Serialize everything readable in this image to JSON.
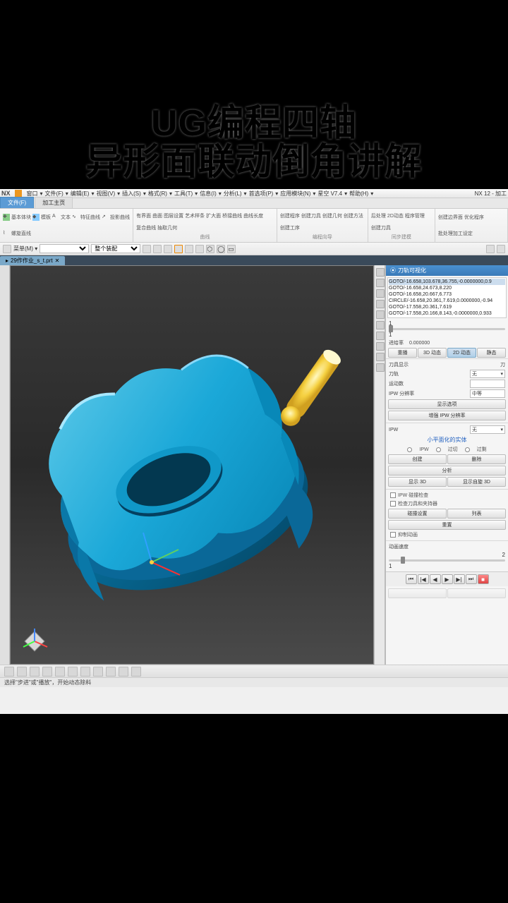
{
  "overlay": {
    "line1": "UG编程四轴",
    "line2": "异形面联动倒角讲解"
  },
  "menubar": {
    "logo": "NX",
    "items": [
      "窗口",
      "文件(F)",
      "编辑(E)",
      "视图(V)",
      "插入(S)",
      "格式(R)",
      "工具(T)",
      "信息(I)",
      "分析(L)",
      "首选项(P)",
      "应用模块(N)",
      "星空 V7.4",
      "帮助(H)"
    ],
    "right": "NX 12 - 加工"
  },
  "tabs": {
    "file": "文件(F)",
    "home": "加工主页"
  },
  "ribbon": {
    "g1": {
      "items": [
        "基本体块",
        "模板",
        "文本",
        "特征曲线",
        "投影曲线",
        "螺旋直线"
      ],
      "label": ""
    },
    "g2": {
      "items": [
        "有界面",
        "曲面",
        "图层设置",
        "艺术样条",
        "扩大面",
        "桥接曲线",
        "曲线长度",
        "复合曲线",
        "抽取几何"
      ],
      "label": "曲线"
    },
    "g3": {
      "items": [
        "创建程序",
        "创建刀具",
        "创建几何",
        "创建方法",
        "创建工序"
      ],
      "label": "编程向导"
    },
    "g4": {
      "items": [
        "后处理",
        "2D动态",
        "程序管理",
        "创建刀具"
      ],
      "label": "同步建模"
    },
    "g5": {
      "items": [
        "创建边界面",
        "优化程序",
        "批处理加工设定"
      ],
      "label": ""
    }
  },
  "doctab": {
    "name": "29作作业_s_t.prt"
  },
  "rightpanel": {
    "title": "刀轨可视化",
    "code": [
      "GOTO/-16.658,103.678,36.755,-0.0000000,0.9",
      "GOTO/-16.658,24.673,8.220",
      "GOTO/-16.658,20.667,6.773",
      "CIRCLE/-16.658,20.361,7.619,0.0000000,-0.94",
      "GOTO/-17.558,20.361,7.619",
      "GOTO/-17.558,20.166,8.143,-0.0000000,0.933"
    ],
    "slider1": "1",
    "slider2": "1",
    "feedrate_label": "进给率",
    "feedrate_val": "0.000000",
    "viewTabs": [
      "重播",
      "3D 动态",
      "2D 动态",
      "静态"
    ],
    "tool_display": "刀具显示",
    "tool_display_val": "刀",
    "tool": "刀轨",
    "tool_val": "无",
    "motion": "运动数",
    "ipw_res": "IPW 分辨率",
    "ipw_res_val": "中等",
    "show_opts": "显示选项",
    "enhance_ipw": "增强 IPW 分辨率",
    "ipw": "IPW",
    "ipw_val": "无",
    "small_facet": "小平面化的实体",
    "radios": [
      "IPW",
      "过切",
      "过剩"
    ],
    "btns1": [
      "创建",
      "删除"
    ],
    "analyze": "分析",
    "btns2": [
      "显示 3D",
      "显示自旋 3D"
    ],
    "chk1": "IPW 碰撞检查",
    "chk2": "检查刀具和夹持器",
    "btns3": [
      "碰撞设置",
      "列表"
    ],
    "reset": "重置",
    "chk3": "抑制动画",
    "anim_speed": "动画速度",
    "speed_val": "2",
    "speed_min": "1"
  },
  "status": "选择\"步进\"或\"播放\"，开始动态除料"
}
